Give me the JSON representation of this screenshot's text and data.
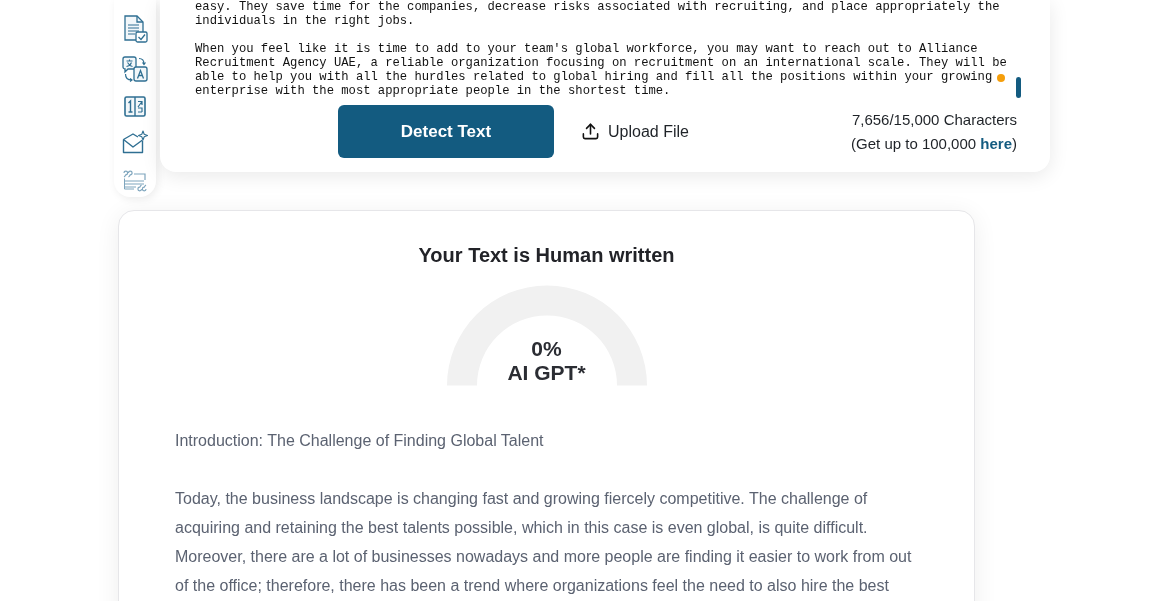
{
  "editor": {
    "paragraphs": [
      "easy. They save time for the companies, decrease risks associated with recruiting, and place appropriately the individuals in the right jobs.",
      "When you feel like it is time to add to your team's global workforce, you may want to reach out to Alliance Recruitment Agency UAE, a reliable organization focusing on recruitment on an international scale. They will be able to help you with all the hurdles related to global hiring and fill all the positions within your growing enterprise with the most appropriate people in the shortest time."
    ]
  },
  "actions": {
    "detect_button": "Detect Text",
    "upload_button": "Upload File"
  },
  "counter": {
    "count": "7,656/15,000 Characters",
    "note_before": "(Get up to 100,000 ",
    "note_link": "here",
    "note_after": ")"
  },
  "result": {
    "title": "Your Text is Human written",
    "gauge": {
      "percent": "0%",
      "label": "AI GPT*"
    },
    "paragraphs": [
      "Introduction: The Challenge of Finding Global Talent",
      "Today, the business landscape is changing fast and growing fiercely competitive. The challenge of acquiring and retaining the best talents possible, which in this case is even global, is quite difficult. Moreover, there are a lot of businesses nowadays and more people are finding it easier to work from out of the office; therefore, there has been a trend where organizations feel the need to also hire the best"
    ]
  }
}
